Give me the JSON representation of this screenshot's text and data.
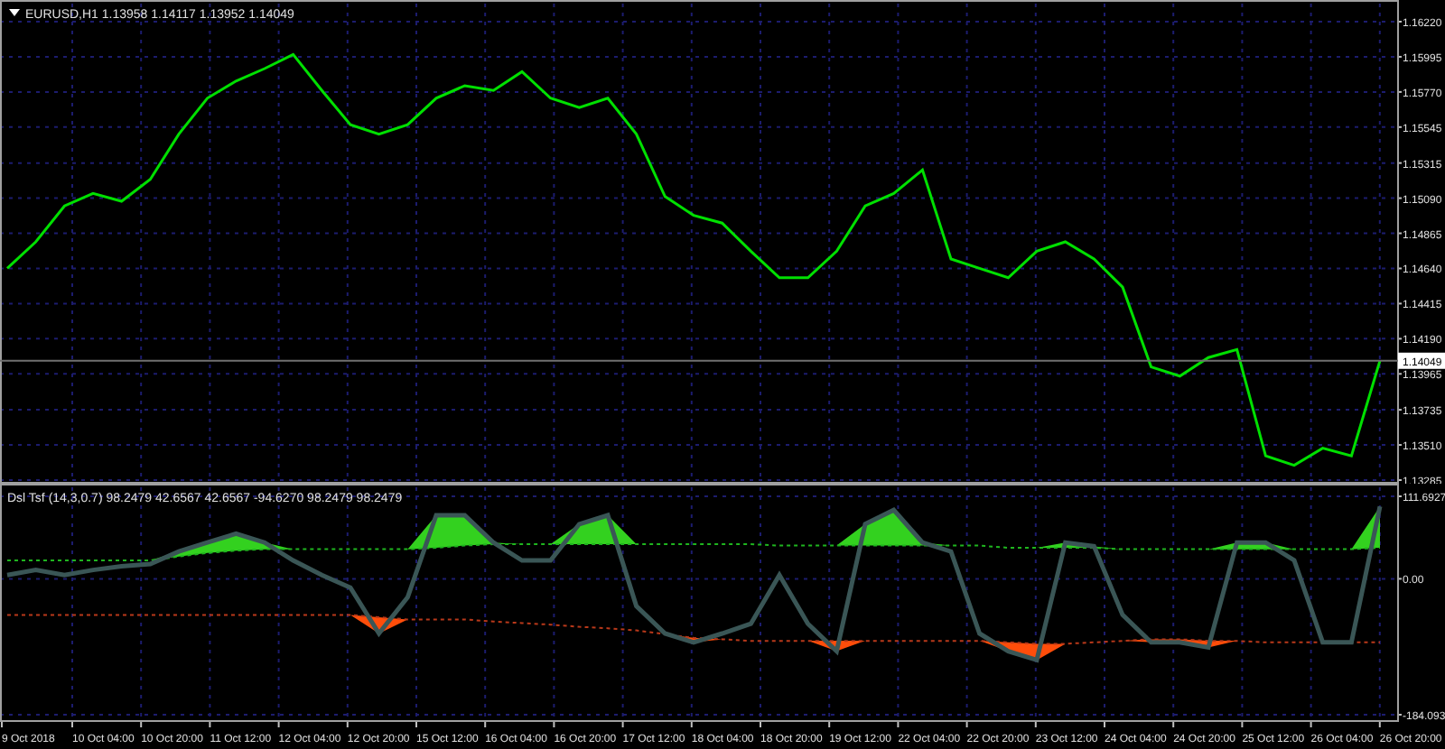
{
  "price_chart": {
    "title": "EURUSD,H1  1.13958 1.14117 1.13952 1.14049",
    "chart_data": {
      "type": "line",
      "grid": true,
      "ylim": [
        1.13285,
        1.1622
      ],
      "yticks": [
        {
          "value": 1.1622,
          "label": "1.16220"
        },
        {
          "value": 1.15995,
          "label": "1.15995"
        },
        {
          "value": 1.1577,
          "label": "1.15770"
        },
        {
          "value": 1.15545,
          "label": "1.15545"
        },
        {
          "value": 1.15315,
          "label": "1.15315"
        },
        {
          "value": 1.1509,
          "label": "1.15090"
        },
        {
          "value": 1.14865,
          "label": "1.14865"
        },
        {
          "value": 1.1464,
          "label": "1.14640"
        },
        {
          "value": 1.14415,
          "label": "1.14415"
        },
        {
          "value": 1.1419,
          "label": "1.14190"
        },
        {
          "value": 1.13965,
          "label": "1.13965"
        },
        {
          "value": 1.13735,
          "label": "1.13735"
        },
        {
          "value": 1.1351,
          "label": "1.13510"
        },
        {
          "value": 1.13285,
          "label": "1.13285"
        }
      ],
      "ref_lines": [
        {
          "axis": "y",
          "value": 1.14049,
          "label": "1.14049"
        }
      ],
      "series": [
        {
          "color": "#00e000",
          "line_style": "solid",
          "values": [
            1.1464,
            1.1481,
            1.1504,
            1.1512,
            1.1507,
            1.1521,
            1.155,
            1.1573,
            1.1584,
            1.1592,
            1.1601,
            1.1578,
            1.1556,
            1.155,
            1.1556,
            1.1573,
            1.1581,
            1.1578,
            1.159,
            1.1573,
            1.1567,
            1.1573,
            1.155,
            1.151,
            1.1498,
            1.1493,
            1.1475,
            1.1458,
            1.1458,
            1.1475,
            1.1504,
            1.1512,
            1.1527,
            1.147,
            1.1464,
            1.1458,
            1.1475,
            1.1481,
            1.147,
            1.1452,
            1.1401,
            1.1395,
            1.1407,
            1.1412,
            1.1344,
            1.1338,
            1.1349,
            1.1344,
            1.1405
          ]
        }
      ]
    }
  },
  "indicator_chart": {
    "title": "Dsl Tsf (14,3,0.7) 98.2479 42.6567 42.6567 -94.6270 98.2479 98.2479",
    "chart_data": {
      "type": "line",
      "grid": true,
      "ylim": [
        -184.093,
        111.6927
      ],
      "yticks": [
        {
          "value": 111.6927,
          "label": "111.6927"
        },
        {
          "value": 0,
          "label": "0.00"
        },
        {
          "value": -184.093,
          "label": "-184.093"
        }
      ],
      "series": [
        {
          "color": "#3a5656",
          "line_style": "solid",
          "values": [
            5,
            12,
            5,
            12,
            17,
            20,
            37,
            49,
            61,
            49,
            25,
            5,
            -12,
            -74,
            -25,
            86,
            86,
            49,
            25,
            25,
            74,
            86,
            -37,
            -74,
            -86,
            -74,
            -61,
            5,
            -61,
            -98,
            74,
            93,
            49,
            37,
            -74,
            -98,
            -110,
            49,
            44,
            -49,
            -86,
            -86,
            -93,
            49,
            49,
            25,
            -86,
            -86,
            98
          ]
        },
        {
          "color": "#1fb51f",
          "line_style": "dashed",
          "values": [
            25,
            25,
            25,
            25,
            25,
            25,
            30,
            35,
            38,
            40,
            40,
            40,
            40,
            40,
            40,
            42,
            45,
            47,
            47,
            47,
            47,
            47,
            47,
            47,
            47,
            47,
            47,
            45,
            45,
            45,
            45,
            45,
            45,
            45,
            45,
            42,
            42,
            42,
            42,
            40,
            40,
            40,
            40,
            40,
            40,
            40,
            40,
            40,
            42
          ]
        },
        {
          "color": "#b8381a",
          "line_style": "dashed",
          "values": [
            -49,
            -49,
            -49,
            -49,
            -49,
            -49,
            -49,
            -49,
            -49,
            -49,
            -49,
            -49,
            -49,
            -52,
            -55,
            -55,
            -55,
            -58,
            -60,
            -62,
            -65,
            -67,
            -70,
            -75,
            -80,
            -82,
            -84,
            -84,
            -84,
            -84,
            -84,
            -84,
            -84,
            -84,
            -84,
            -86,
            -88,
            -88,
            -86,
            -84,
            -82,
            -82,
            -84,
            -84,
            -86,
            -86,
            -86,
            -86,
            -86
          ]
        }
      ]
    }
  },
  "time_axis": [
    "9 Oct 2018",
    "10 Oct 04:00",
    "10 Oct 20:00",
    "11 Oct 12:00",
    "12 Oct 04:00",
    "12 Oct 20:00",
    "15 Oct 12:00",
    "16 Oct 04:00",
    "16 Oct 20:00",
    "17 Oct 12:00",
    "18 Oct 04:00",
    "18 Oct 20:00",
    "19 Oct 12:00",
    "22 Oct 04:00",
    "22 Oct 20:00",
    "23 Oct 12:00",
    "24 Oct 04:00",
    "24 Oct 20:00",
    "25 Oct 12:00",
    "26 Oct 04:00",
    "26 Oct 20:00"
  ]
}
